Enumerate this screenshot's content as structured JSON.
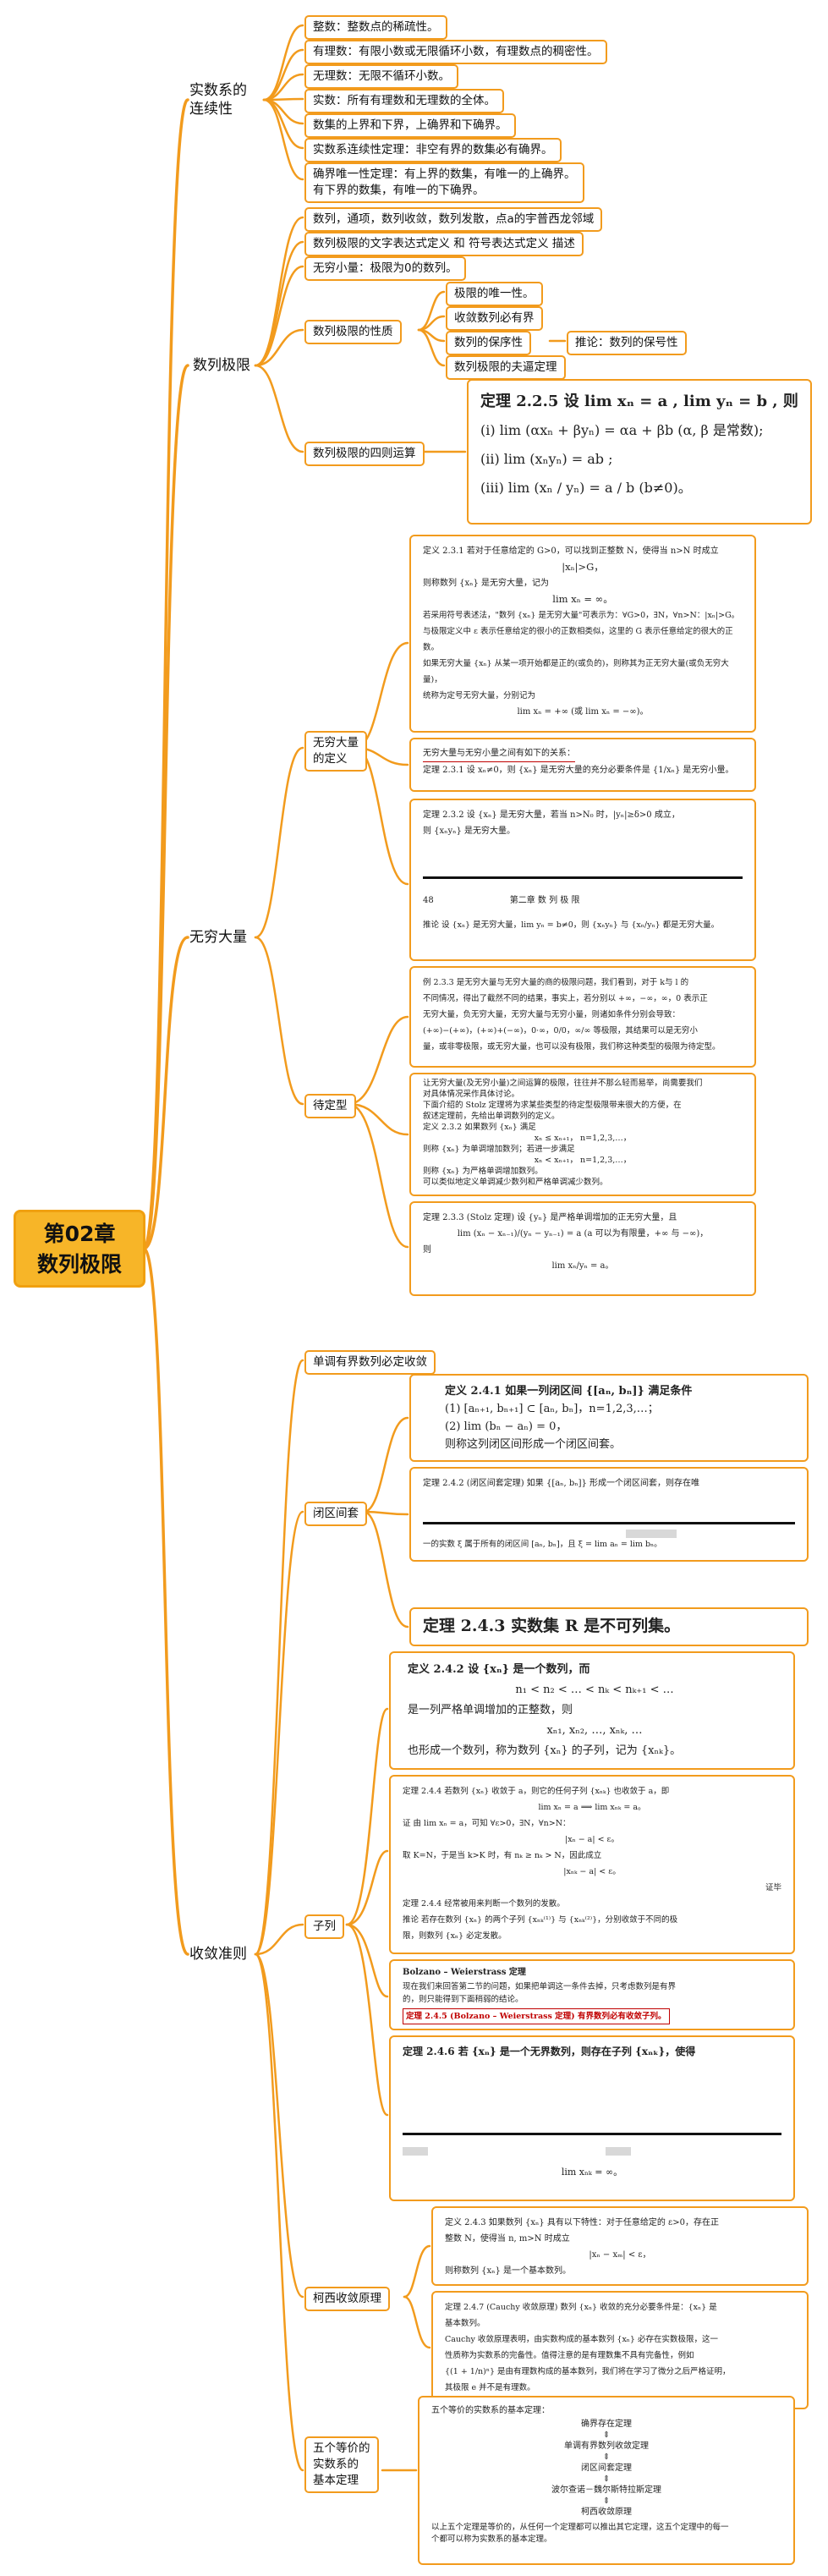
{
  "root": {
    "title_line1": "第02章",
    "title_line2": "数列极限"
  },
  "colors": {
    "branch": "#f29b1d",
    "root_fill": "#f7b528",
    "underline": "#c00000"
  },
  "topics": {
    "completeness": {
      "line1": "实数系的",
      "line2": "连续性"
    },
    "limits": "数列极限",
    "infinity": "无穷大量",
    "convergence": "收敛准则"
  },
  "completeness_leaves": [
    "整数：整数点的稀疏性。",
    "有理数：有限小数或无限循环小数，有理数点的稠密性。",
    "无理数：无限不循环小数。",
    "实数：所有有理数和无理数的全体。",
    "数集的上界和下界，上确界和下确界。",
    "实数系连续性定理：非空有界的数集必有确界。",
    "确界唯一性定理：有上界的数集，有唯一的上确界。",
    "有下界的数集，有唯一的下确界。"
  ],
  "limits_leaves": {
    "neighborhood": "数列，通项，数列收敛，数列发散，点a的宇普西龙邻域",
    "definition": "数列极限的文字表达式定义 和 符号表达式定义 描述",
    "infinitesimal": "无穷小量：极限为0的数列。",
    "properties": "数列极限的性质",
    "arith": "数列极限的四则运算"
  },
  "property_leaves": [
    "极限的唯一性。",
    "收敛数列必有界",
    "数列的保序性",
    "数列极限的夫逼定理"
  ],
  "sign_corollary": "推论：数列的保号性",
  "theorem_225": {
    "head": "定理 2.2.5   设 lim xₙ = a , lim yₙ = b , 则",
    "i": "(i)  lim (αxₙ + βyₙ) = αa + βb  (α, β 是常数);",
    "ii": "(ii)  lim (xₙyₙ) = ab ;",
    "iii": "(iii)  lim (xₙ / yₙ) = a / b  (b≠0)。"
  },
  "infinity_leaves": {
    "definition": "无穷大量的定义",
    "indeterminate": "待定型"
  },
  "def_231": {
    "l1": "定义 2.3.1   若对于任意给定的 G>0，可以找到正整数 N，使得当 n>N 时成立",
    "l2": "|xₙ|>G，",
    "l3": "则称数列 {xₙ} 是无穷大量，记为",
    "l4": "lim xₙ = ∞。",
    "l5": "若采用符号表述法，\"数列 {xₙ} 是无穷大量\"可表示为：∀G>0，∃N，∀n>N：|xₙ|>G。",
    "l6": "与极限定义中 ε 表示任意给定的很小的正数相类似，这里的 G 表示任意给定的很大的正数。",
    "l7": "如果无穷大量 {xₙ} 从某一项开始都是正的(或负的)，则称其为正无穷大量(或负无穷大量)，",
    "l8": "统称为定号无穷大量，分别记为",
    "l9": "lim xₙ = +∞ (或 lim xₙ = −∞)。"
  },
  "thm_231": {
    "l1": "无穷大量与无穷小量之间有如下的关系：",
    "l2": "定理 2.3.1   设 xₙ≠0，则 {xₙ} 是无穷大量的充分必要条件是 {1/xₙ} 是无穷小量。"
  },
  "thm_232": {
    "l1": "定理 2.3.2   设 {xₙ} 是无穷大量，若当 n>N₀ 时，|yₙ|≥δ>0 成立，",
    "l2": "则 {xₙyₙ} 是无穷大量。",
    "page": "48",
    "header": "第二章   数 列 极 限",
    "corollary": "推论   设 {xₙ} 是无穷大量，lim yₙ = b≠0，则 {xₙyₙ} 与 {xₙ/yₙ} 都是无穷大量。"
  },
  "indeterminate_text": {
    "l1": "例 2.3.3 是无穷大量与无穷大量的商的极限问题，我们看到，对于 k与 l 的",
    "l2": "不同情况，得出了截然不同的结果，事实上，若分别以 +∞，−∞，∞，0 表示正",
    "l3": "无穷大量，负无穷大量，无穷大量与无穷小量，则诸如条件分别会导致：",
    "l4": "(+∞)−(+∞)，(+∞)+(−∞)，0·∞，0/0，∞/∞ 等极限，其结果可以是无穷小",
    "l5": "量，或非零极限，或无穷大量，也可以没有极限，我们称这种类型的极限为待定型。"
  },
  "stolz_pre": {
    "l1": "让无穷大量(及无穷小量)之间运算的极限，往往并不那么轻而易举，尚需要我们",
    "l2": "对具体情况采作具体讨论。",
    "l3": "下面介绍的 Stolz 定理将为求某些类型的待定型极限带来很大的方便，在",
    "l4": "叙述定理前，先给出单调数列的定义。",
    "l5": "定义 2.3.2   如果数列 {xₙ} 满足",
    "l6": "xₙ ≤ xₙ₊₁，   n=1,2,3,…，",
    "l7": "则称 {xₙ} 为单调增加数列；若进一步满足",
    "l8": "xₙ < xₙ₊₁，   n=1,2,3,…，",
    "l9": "则称 {xₙ} 为严格单调增加数列。",
    "l10": "可以类似地定义单调减少数列和严格单调减少数列。"
  },
  "stolz": {
    "l1": "定理 2.3.3 (Stolz 定理)   设 {yₙ} 是严格单调增加的正无穷大量，且",
    "l2": "lim (xₙ − xₙ₋₁)/(yₙ − yₙ₋₁) = a   (a 可以为有限量，+∞ 与 −∞)，",
    "l3": "则",
    "l4": "lim xₙ/yₙ = a。"
  },
  "conv_leaves": {
    "monotone": "单调有界数列必定收敛",
    "nested": "闭区间套",
    "subsequence": "子列",
    "cauchy": "柯西收敛原理",
    "equiv_line1": "五个等价的",
    "equiv_line2": "实数系的",
    "equiv_line3": "基本定理"
  },
  "def_241": {
    "l1": "定义 2.4.1   如果一列闭区间 {[aₙ, bₙ]} 满足条件",
    "l2": "(1) [aₙ₊₁, bₙ₊₁] ⊂ [aₙ, bₙ]，n=1,2,3,…；",
    "l3": "(2) lim (bₙ − aₙ) = 0，",
    "l4": "则称这列闭区间形成一个闭区间套。"
  },
  "thm_242": {
    "l1": "定理 2.4.2 (闭区间套定理)   如果 {[aₙ, bₙ]} 形成一个闭区间套，则存在唯",
    "l2": "一的实数 ξ 属于所有的闭区间 [aₙ, bₙ]，且 ξ = lim aₙ = lim bₙ。"
  },
  "thm_243": "定理 2.4.3   实数集 R 是不可列集。",
  "def_242": {
    "l1": "定义 2.4.2   设 {xₙ} 是一个数列，而",
    "l2": "n₁ < n₂ < … < nₖ < nₖ₊₁ < …",
    "l3": "是一列严格单调增加的正整数，则",
    "l4": "xₙ₁, xₙ₂, …, xₙₖ, …",
    "l5": "也形成一个数列，称为数列 {xₙ} 的子列，记为 {xₙₖ}。"
  },
  "thm_244": {
    "l1": "定理 2.4.4   若数列 {xₙ} 收敛于 a，则它的任何子列 {xₙₖ} 也收敛于 a，即",
    "l2": "lim xₙ = a  ⟹  lim xₙₖ = a。",
    "l3": "证   由 lim xₙ = a，可知 ∀ε>0，∃N，∀n>N：",
    "l4": "|xₙ − a| < ε。",
    "l5": "取 K=N，于是当 k>K 时，有 nₖ ≥ nₖ > N，因此成立",
    "l6": "|xₙₖ − a| < ε。",
    "l7": "证毕",
    "l8": "定理 2.4.4 经常被用来判断一个数列的发散。",
    "l9": "推论   若存在数列 {xₙ} 的两个子列 {xₙₖ⁽¹⁾} 与 {xₙₖ⁽²⁾}，分别收敛于不同的极",
    "l10": "限，则数列 {xₙ} 必定发散。"
  },
  "bolzano": {
    "title": "Bolzano – Weierstrass 定理",
    "l1": "现在我们来回答第二节的问题，如果把单调这一条件去掉，只考虑数列是有界",
    "l2": "的，则只能得到下面稍弱的结论。",
    "l3": "定理 2.4.5 (Bolzano – Weierstrass 定理)   有界数列必有收敛子列。"
  },
  "thm_246": {
    "l1": "定理 2.4.6   若 {xₙ} 是一个无界数列，则存在子列 {xₙₖ}，使得",
    "l2": "lim xₙₖ = ∞。"
  },
  "def_243": {
    "l1": "定义 2.4.3   如果数列 {xₙ} 具有以下特性：对于任意给定的 ε>0，存在正",
    "l2": "整数 N，使得当 n, m>N 时成立",
    "l3": "|xₙ − xₘ| < ε，",
    "l4": "则称数列 {xₙ} 是一个基本数列。"
  },
  "thm_247": {
    "l1": "定理 2.4.7 (Cauchy 收敛原理)   数列 {xₙ} 收敛的充分必要条件是：{xₙ} 是",
    "l2": "基本数列。",
    "l3": "Cauchy 收敛原理表明，由实数构成的基本数列 {xₙ} 必存在实数极限，这一",
    "l4": "性质称为实数系的完备性。值得注意的是有理数集不具有完备性，例如",
    "l5": "{(1 + 1/n)ⁿ} 是由有理数构成的基本数列，我们将在学习了微分之后严格证明，",
    "l6": "其极限 e 并不是有理数。"
  },
  "equiv": {
    "intro": "五个等价的实数系的基本定理：",
    "items": [
      "确界存在定理",
      "单调有界数列收敛定理",
      "闭区间套定理",
      "波尔查诺－魏尔斯特拉斯定理",
      "柯西收敛原理"
    ],
    "arrow": "⇕",
    "foot1": "以上五个定理是等价的，从任何一个定理都可以推出其它定理，这五个定理中的每一",
    "foot2": "个都可以称为实数系的基本定理。"
  }
}
